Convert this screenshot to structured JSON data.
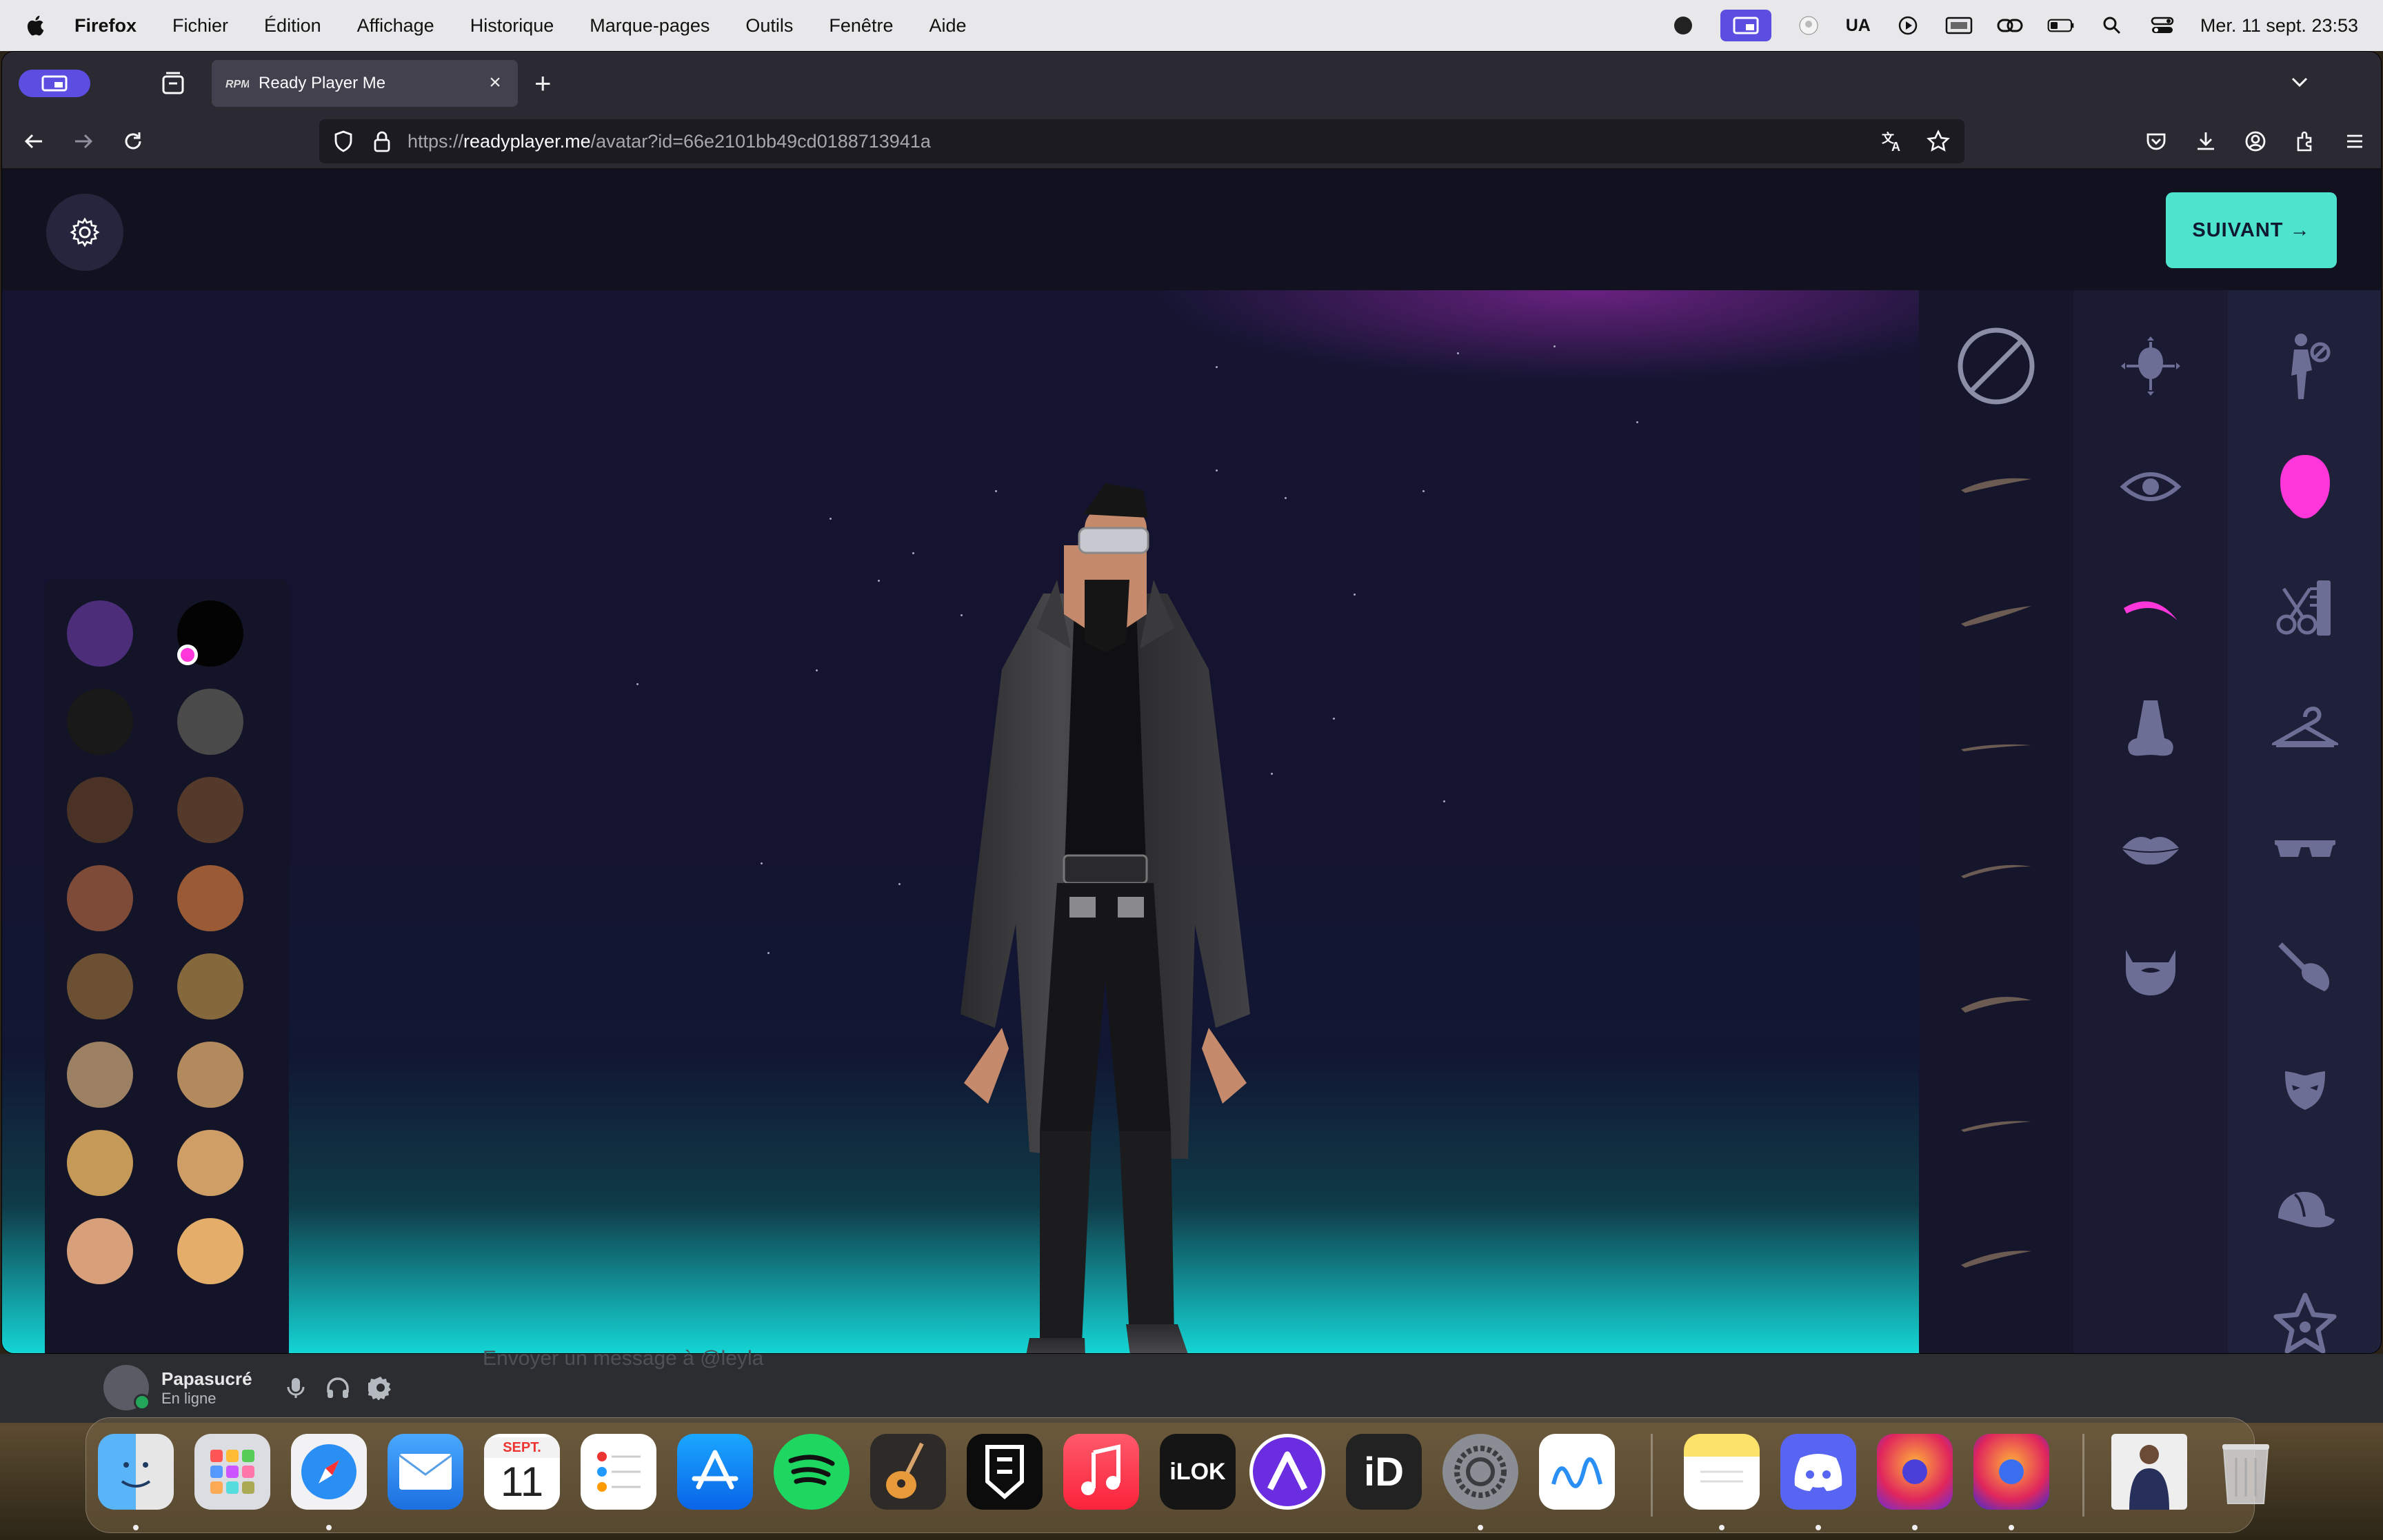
{
  "menubar": {
    "app_name": "Firefox",
    "items": [
      "Fichier",
      "Édition",
      "Affichage",
      "Historique",
      "Marque-pages",
      "Outils",
      "Fenêtre",
      "Aide"
    ],
    "keyboard_layout": "UA",
    "clock": "Mer. 11 sept.  23:53",
    "status_icons": [
      "recording-icon",
      "screen-share-icon",
      "accessibility-icon",
      "play-icon",
      "ci-icon",
      "link-icon",
      "battery-icon",
      "spotlight-icon",
      "control-center-icon"
    ]
  },
  "browser": {
    "tab_title": "Ready Player Me",
    "url_prefix": "https://",
    "url_host": "readyplayer.me",
    "url_path": "/avatar?id=66e2101bb49cd0188713941a"
  },
  "app": {
    "next_button": "SUIVANT →",
    "palette_title": "",
    "colors": {
      "accent": "#4de3cc",
      "highlight": "#ff36d9",
      "icon_muted": "#6c6e96"
    },
    "swatches": [
      [
        "#4b2d7a",
        "#030303"
      ],
      [
        "#191919",
        "#4a4a4a"
      ],
      [
        "#4a3326",
        "#553a2b"
      ],
      [
        "#7d4b38",
        "#9a5a36"
      ],
      [
        "#6b5034",
        "#86683d"
      ],
      [
        "#9c8064",
        "#b28a5e"
      ],
      [
        "#c59957",
        "#cf9d66"
      ],
      [
        "#d7a07b",
        "#e4ae6a"
      ]
    ],
    "selected_swatch": "row1-col2",
    "part_icons": [
      "body-shape-icon",
      "eye-icon",
      "eyebrow-icon",
      "nose-icon",
      "lips-icon",
      "beard-icon"
    ],
    "category_icons": [
      "body-icon",
      "head-icon",
      "hairstyle-icon",
      "outfit-icon",
      "glasses-icon",
      "makeup-icon",
      "mask-icon",
      "cap-icon",
      "star-icon"
    ],
    "style_options": [
      "none-option",
      "eyebrow-style-1",
      "eyebrow-style-2",
      "eyebrow-style-3",
      "eyebrow-style-4",
      "eyebrow-style-5",
      "eyebrow-style-6",
      "eyebrow-style-7"
    ]
  },
  "discord": {
    "username": "Papasucré",
    "status": "En ligne",
    "message_placeholder": "Envoyer un message à @leyla"
  },
  "dock": {
    "calendar_month": "SEPT.",
    "calendar_day": "11",
    "apps": [
      "Finder",
      "Launchpad",
      "Safari",
      "Mail",
      "Calendrier",
      "Rappels",
      "App Store",
      "Spotify",
      "GarageBand",
      "Ninja",
      "Musique",
      "iLok",
      "Arc",
      "iD",
      "Réglages Système",
      "Freeform",
      "Notes",
      "Discord",
      "Firefox",
      "Firefox Developer",
      "Video",
      "Corbeille"
    ]
  }
}
